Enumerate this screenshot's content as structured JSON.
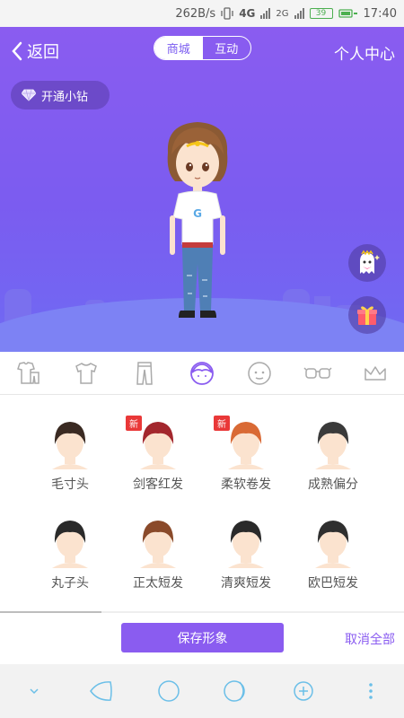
{
  "status_bar": {
    "speed": "262B/s",
    "network1": "4G",
    "network2": "2G",
    "battery": "39",
    "time": "17:40"
  },
  "header": {
    "back_label": "返回",
    "tabs": [
      "商城",
      "互动"
    ],
    "profile_label": "个人中心"
  },
  "vip": {
    "label": "开通小钻"
  },
  "categories": [
    "outfit-set-icon",
    "shirt-icon",
    "pants-icon",
    "hair-icon",
    "face-icon",
    "glasses-icon",
    "crown-icon"
  ],
  "items": [
    {
      "label": "毛寸头",
      "is_new": "",
      "hair_color": "#3a2a22"
    },
    {
      "label": "剑客红发",
      "is_new": "新",
      "hair_color": "#a3272d"
    },
    {
      "label": "柔软卷发",
      "is_new": "新",
      "hair_color": "#d96a35"
    },
    {
      "label": "成熟偏分",
      "is_new": "",
      "hair_color": "#3a3a3a"
    },
    {
      "label": "丸子头",
      "is_new": "",
      "hair_color": "#2a2a2a"
    },
    {
      "label": "正太短发",
      "is_new": "",
      "hair_color": "#8a4a2a"
    },
    {
      "label": "清爽短发",
      "is_new": "",
      "hair_color": "#2a2a2a"
    },
    {
      "label": "欧巴短发",
      "is_new": "",
      "hair_color": "#2f2f2f"
    }
  ],
  "actions": {
    "save_label": "保存形象",
    "cancel_label": "取消全部"
  },
  "colors": {
    "accent": "#8a5cf0",
    "badge": "#e93838"
  }
}
